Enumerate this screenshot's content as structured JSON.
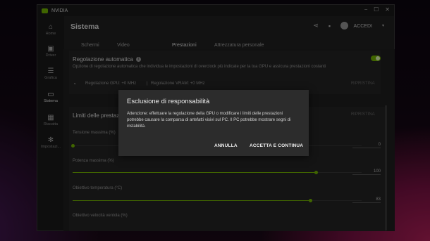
{
  "window": {
    "app_name": "NVIDIA",
    "controls": [
      "⎯",
      "☐",
      "✕"
    ]
  },
  "sidebar": {
    "items": [
      {
        "label": "Home",
        "icon": "home-icon"
      },
      {
        "label": "Driver",
        "icon": "driver-icon"
      },
      {
        "label": "Grafica",
        "icon": "sliders-icon"
      },
      {
        "label": "Sistema",
        "icon": "monitor-icon"
      },
      {
        "label": "Riacatta",
        "icon": "redeem-icon"
      },
      {
        "label": "Impostazi...",
        "icon": "gear-icon"
      }
    ]
  },
  "header": {
    "title": "Sistema",
    "account_label": "ACCEDI"
  },
  "tabs": [
    "Schermi",
    "Video",
    "Prestazioni",
    "Attrezzatura personale"
  ],
  "auto_tuning": {
    "title": "Regolazione automatica",
    "info_glyph": "i",
    "description": "Opzione di regolazione automatica che individua le impostazioni di overclock più indicate per la tua GPU e assicura prestazioni costanti",
    "gpu_adjust": "Regolazione GPU: +0 MHz",
    "separator": "|",
    "vram_adjust": "Regolazione VRAM: +0 MHz",
    "reset_label": "RIPRISTINA",
    "enabled": true
  },
  "limits": {
    "title": "Limiti delle prestazioni",
    "reset_label": "RIPRISTINA",
    "sliders": [
      {
        "label": "Tensione massima (%)",
        "value": "0",
        "fraction": 0.0
      },
      {
        "label": "Potenza massima (%)",
        "value": "100",
        "fraction": 0.84
      },
      {
        "label": "Obiettivo temperatura (°C)",
        "value": "83",
        "fraction": 0.81
      },
      {
        "label": "Obiettivo velocità ventola (%)",
        "value": "",
        "fraction": 0.0
      }
    ]
  },
  "dialog": {
    "title": "Esclusione di responsabilità",
    "text": "Attenzione: effettuare la regolazione della GPU o modificare i limiti delle prestazioni potrebbe causare la comparsa di artefatti visivi sul PC. Il PC potrebbe mostrare segni di instabilità.",
    "cancel_label": "ANNULLA",
    "accept_label": "ACCETTA E CONTINUA"
  },
  "colors": {
    "accent": "#76b900",
    "background": "#202020",
    "dialog": "#2c2c2c"
  }
}
